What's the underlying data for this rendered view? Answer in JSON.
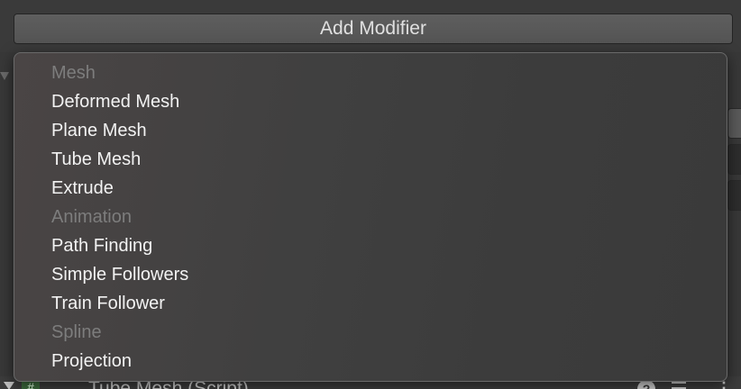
{
  "toolbar": {
    "add_modifier_label": "Add Modifier"
  },
  "menu": {
    "items": [
      {
        "kind": "header",
        "label": "Mesh"
      },
      {
        "kind": "item",
        "label": "Deformed Mesh"
      },
      {
        "kind": "item",
        "label": "Plane Mesh"
      },
      {
        "kind": "item",
        "label": "Tube Mesh"
      },
      {
        "kind": "item",
        "label": "Extrude"
      },
      {
        "kind": "header",
        "label": "Animation"
      },
      {
        "kind": "item",
        "label": "Path Finding"
      },
      {
        "kind": "item",
        "label": "Simple Followers"
      },
      {
        "kind": "item",
        "label": "Train Follower"
      },
      {
        "kind": "header",
        "label": "Spline"
      },
      {
        "kind": "item",
        "label": "Projection"
      }
    ]
  },
  "component": {
    "title": "Tube Mesh (Script)",
    "script_icon": "#",
    "icons": [
      "foldout-arrow-icon",
      "script-icon",
      "help-icon",
      "preset-icon",
      "more-options-icon"
    ]
  },
  "colors": {
    "menu_header_text": "#7d7d7d",
    "menu_item_text": "#f2f2f2",
    "button_background": "#585858",
    "panel_background": "#383838"
  }
}
